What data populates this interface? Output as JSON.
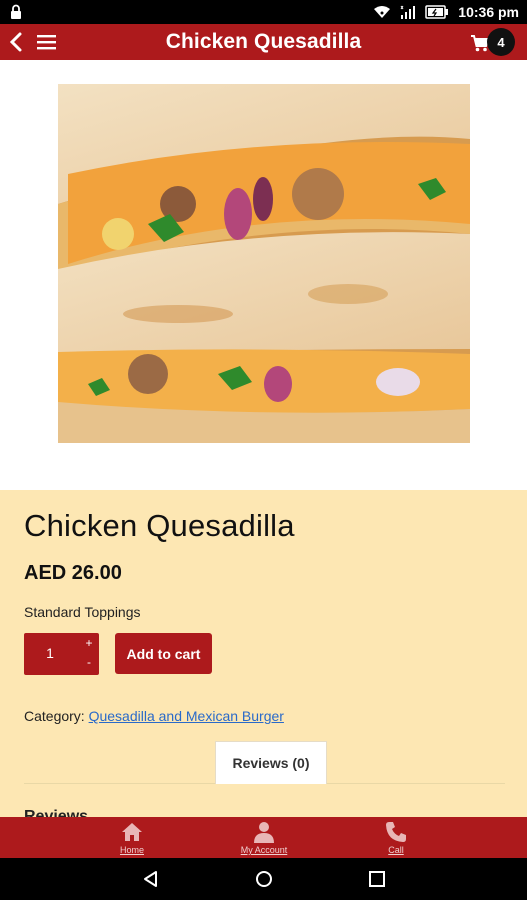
{
  "status_bar": {
    "time": "10:36 pm",
    "icons": [
      "lock-icon",
      "wifi-icon",
      "signal-icon",
      "battery-icon"
    ]
  },
  "app_bar": {
    "title": "Chicken Quesadilla",
    "cart_count": "4",
    "icons": [
      "back-arrow-icon",
      "hamburger-menu-icon",
      "cart-icon"
    ],
    "color": "#ad1a1c"
  },
  "product": {
    "image_alt": "Chicken quesadilla photo",
    "title": "Chicken Quesadilla",
    "price": "AED 26.00",
    "toppings_label": "Standard Toppings",
    "quantity": "1",
    "plus_label": "+",
    "minus_label": "-",
    "add_to_cart_label": "Add to cart",
    "category_label": "Category:",
    "category_link": "Quesadilla and Mexican Burger",
    "reviews_tab": "Reviews (0)",
    "reviews_heading": "Reviews",
    "background": "#fde7b3"
  },
  "bottom_nav": {
    "items": [
      {
        "label": "Home",
        "icon": "home-icon"
      },
      {
        "label": "My Account",
        "icon": "account-icon"
      },
      {
        "label": "Call",
        "icon": "phone-icon"
      }
    ]
  },
  "system_nav": {
    "icons": [
      "back-triangle-icon",
      "home-circle-icon",
      "recents-square-icon"
    ]
  }
}
